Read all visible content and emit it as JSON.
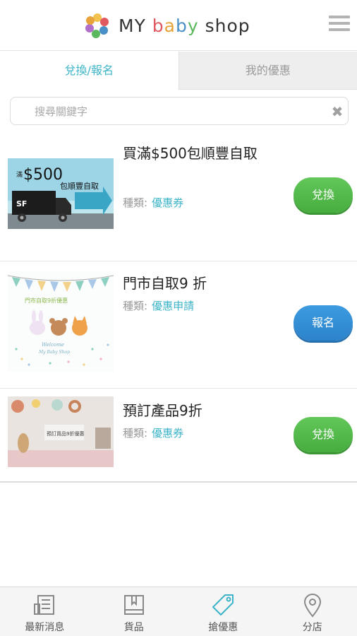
{
  "header": {
    "logo_text_parts": [
      "MY ",
      "b",
      "a",
      "b",
      "y",
      " shop"
    ],
    "menu_icon": "hamburger-menu-icon"
  },
  "tabs": [
    {
      "label": "兌換/報名",
      "active": true
    },
    {
      "label": "我的優惠",
      "active": false
    }
  ],
  "search": {
    "placeholder": "搜尋關鍵字",
    "value": "",
    "clear_icon": "✖"
  },
  "items": [
    {
      "title": "買滿$500包順豐自取",
      "type_label": "種類:",
      "type_value": "優惠券",
      "action": "兌換",
      "thumb": {
        "big": "$500",
        "small": "滿",
        "line": "包順豐自取",
        "logo": "SF"
      }
    },
    {
      "title": "門市自取9 折",
      "type_label": "種類:",
      "type_value": "優惠申請",
      "action": "報名",
      "thumb": {
        "caption": "門市自取9折優惠",
        "welcome": "Welcome",
        "shop": "My Baby Shop"
      }
    },
    {
      "title": "預訂產品9折",
      "type_label": "種類:",
      "type_value": "優惠券",
      "action": "兌換",
      "thumb": {
        "caption": "預訂貨品9折優惠"
      }
    }
  ],
  "bottom_nav": [
    {
      "label": "最新消息",
      "icon": "news-icon"
    },
    {
      "label": "貨品",
      "icon": "book-icon"
    },
    {
      "label": "搶優惠",
      "icon": "tag-icon"
    },
    {
      "label": "分店",
      "icon": "location-pin-icon"
    }
  ],
  "colors": {
    "accent": "#3db4c8",
    "green_button": "#52b849",
    "blue_button": "#3590d6",
    "inactive_tab": "#eeeeee"
  }
}
